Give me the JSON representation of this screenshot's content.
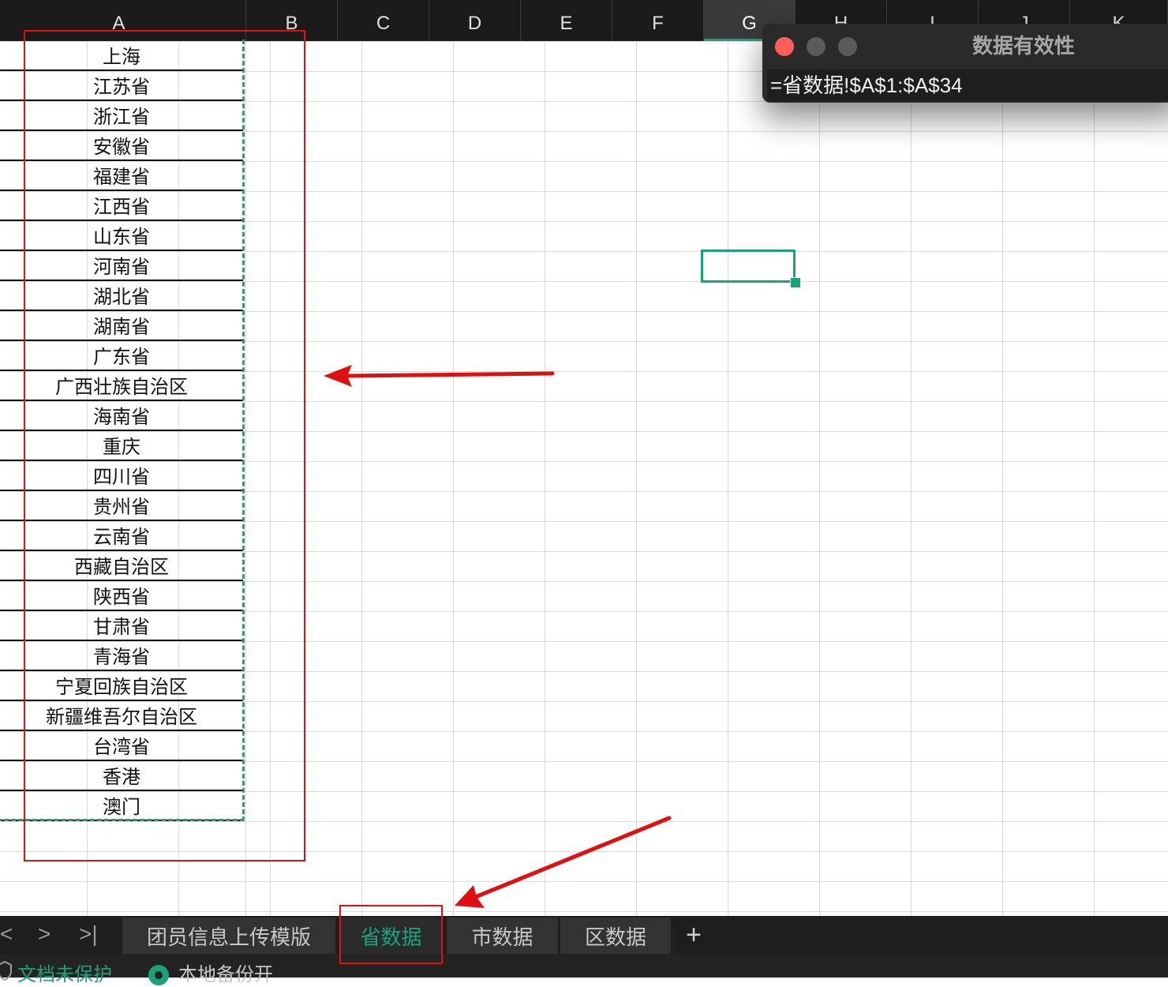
{
  "columns": [
    "A",
    "B",
    "C",
    "D",
    "E",
    "F",
    "G",
    "H",
    "I",
    "J",
    "K"
  ],
  "active_column": "G",
  "provinces": [
    "上海",
    "江苏省",
    "浙江省",
    "安徽省",
    "福建省",
    "江西省",
    "山东省",
    "河南省",
    "湖北省",
    "湖南省",
    "广东省",
    "广西壮族自治区",
    "海南省",
    "重庆",
    "四川省",
    "贵州省",
    "云南省",
    "西藏自治区",
    "陕西省",
    "甘肃省",
    "青海省",
    "宁夏回族自治区",
    "新疆维吾尔自治区",
    "台湾省",
    "香港",
    "澳门"
  ],
  "dialog": {
    "title": "数据有效性",
    "formula": "=省数据!$A$1:$A$34"
  },
  "sheet_tabs": [
    {
      "label": "团员信息上传模版",
      "active": false
    },
    {
      "label": "省数据",
      "active": true
    },
    {
      "label": "市数据",
      "active": false
    },
    {
      "label": "区数据",
      "active": false
    }
  ],
  "nav": {
    "prev": "<",
    "next": ">",
    "last": ">|",
    "add": "+"
  },
  "status": {
    "protection": "文档未保护",
    "backup": "本地备份开"
  },
  "colors": {
    "accent": "#1aa37a",
    "annotation_red": "#e01010",
    "close": "#ff5f57",
    "inactive_light": "#5a5a5a"
  }
}
